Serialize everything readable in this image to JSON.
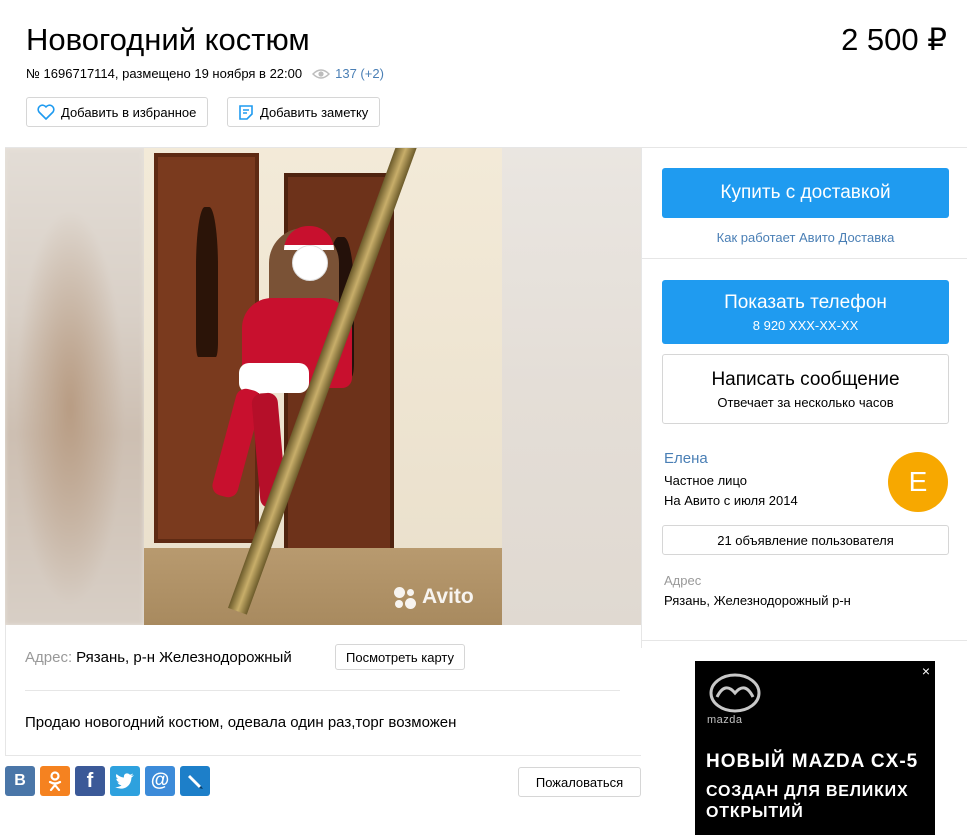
{
  "listing": {
    "title": "Новогодний костюм",
    "price": "2 500 ₽",
    "meta_text": "№ 1696717114, размещено 19 ноября в 22:00",
    "views": "137 (+2)",
    "favorite_label": "Добавить в избранное",
    "note_label": "Добавить заметку"
  },
  "photo": {
    "watermark": "Avito"
  },
  "details": {
    "address_label": "Адрес:",
    "address_value": "Рязань, р-н Железнодорожный",
    "map_button": "Посмотреть карту",
    "description": "Продаю новогодний костюм, одевала один раз,торг возможен"
  },
  "share": {
    "items": [
      {
        "name": "vk",
        "glyph": "B",
        "color": "#4a76a8"
      },
      {
        "name": "ok",
        "glyph": "ok",
        "color": "#f58220"
      },
      {
        "name": "facebook",
        "glyph": "f",
        "color": "#3b5998"
      },
      {
        "name": "twitter",
        "glyph": "t",
        "color": "#2ea1de"
      },
      {
        "name": "mail",
        "glyph": "@",
        "color": "#3c8bd9"
      },
      {
        "name": "livejournal",
        "glyph": "✎",
        "color": "#1d7fc9"
      }
    ]
  },
  "complain_label": "Пожаловаться",
  "sidebar": {
    "buy_label": "Купить с доставкой",
    "delivery_link": "Как работает Авито Доставка",
    "phone_label": "Показать телефон",
    "phone_masked": "8 920 XXX-XX-XX",
    "message_label": "Написать сообщение",
    "message_hint": "Отвечает за несколько часов",
    "seller_name": "Елена",
    "seller_type": "Частное лицо",
    "seller_since": "На Авито с июля 2014",
    "avatar_letter": "E",
    "ads_count_label": "21 объявление пользователя",
    "address_heading": "Адрес",
    "address_value": "Рязань, Железнодорожный р-н"
  },
  "ad": {
    "close_glyph": "×",
    "brand": "mazda",
    "headline": "НОВЫЙ MAZDA CX-5",
    "subheadline": "СОЗДАН ДЛЯ ВЕЛИКИХ ОТКРЫТИЙ"
  },
  "colors": {
    "accent_blue": "#1f9bf0",
    "link_blue": "#4a7fb5",
    "avatar_orange": "#f7a800"
  }
}
